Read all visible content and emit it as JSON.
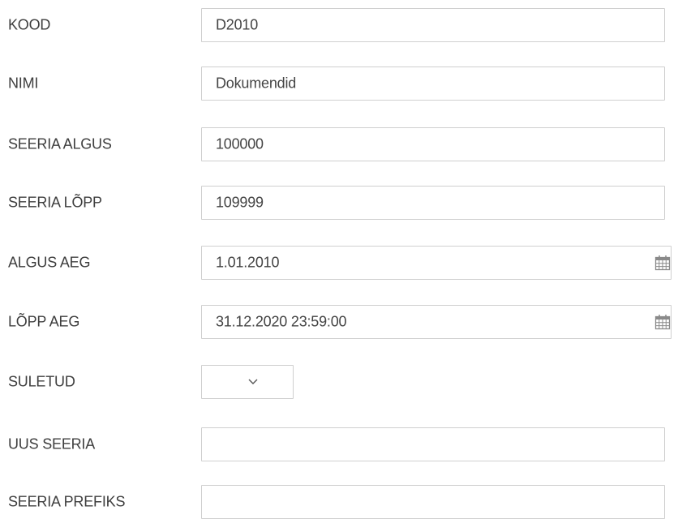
{
  "form": {
    "kood": {
      "label": "KOOD",
      "value": "D2010"
    },
    "nimi": {
      "label": "NIMI",
      "value": "Dokumendid"
    },
    "seeria_algus": {
      "label": "SEERIA ALGUS",
      "value": "100000"
    },
    "seeria_lopp": {
      "label": "SEERIA LÕPP",
      "value": "109999"
    },
    "algus_aeg": {
      "label": "ALGUS AEG",
      "value": "1.01.2010",
      "icon": "calendar-icon"
    },
    "lopp_aeg": {
      "label": "LÕPP AEG",
      "value": "31.12.2020 23:59:00",
      "icon": "calendar-icon"
    },
    "suletud": {
      "label": "SULETUD",
      "value": "",
      "icon": "chevron-down-icon"
    },
    "uus_seeria": {
      "label": "UUS SEERIA",
      "value": ""
    },
    "seeria_prefiks": {
      "label": "SEERIA PREFIKS",
      "value": ""
    }
  },
  "colors": {
    "border": "#cfcfcf",
    "label_text": "#3e3e3e",
    "value_text": "#444444",
    "icon": "#8a8a8a"
  }
}
